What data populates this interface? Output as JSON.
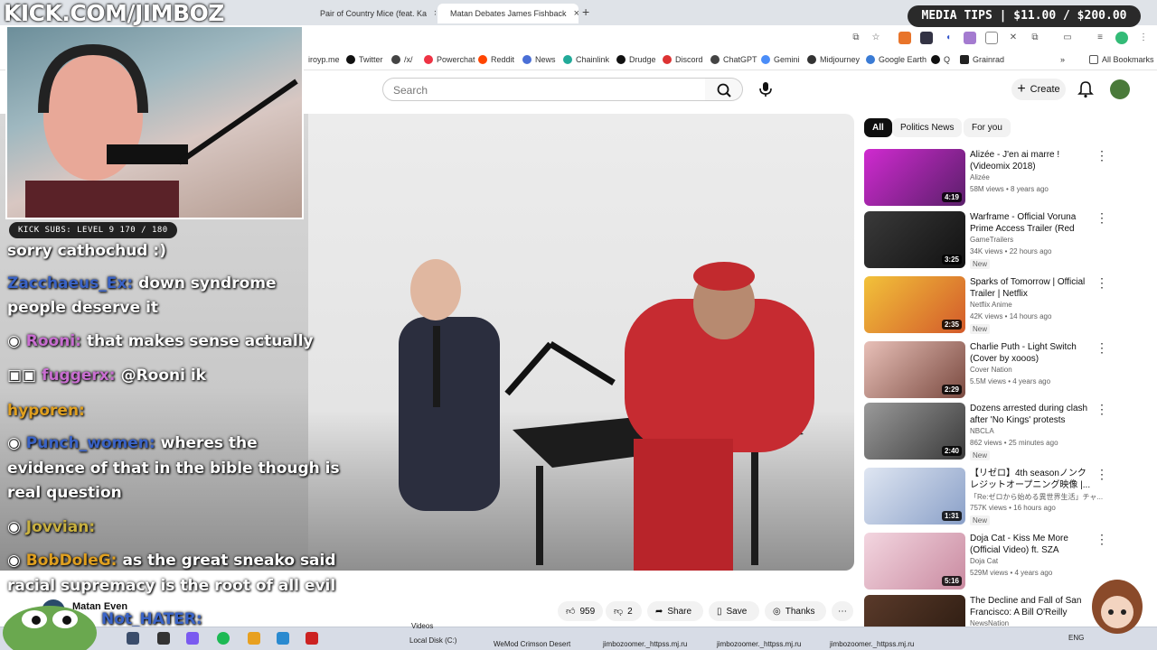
{
  "overlay": {
    "kick_title": "KICK.COM/JIMBOZ",
    "media_tips": "MEDIA TIPS | $11.00 / $200.00",
    "kick_subs": "KICK SUBS: LEVEL 9 170 / 180"
  },
  "browser": {
    "tabs": [
      {
        "label": "Pair of Country Mice (feat. Ka",
        "active": false
      },
      {
        "label": "Matan Debates James Fishback",
        "active": true
      }
    ],
    "bookmarks": [
      "iroyp.me",
      "Twitter",
      "/x/",
      "Powerchat",
      "Reddit",
      "News",
      "Chainlink",
      "Drudge",
      "Discord",
      "ChatGPT",
      "Gemini",
      "Midjourney",
      "Google Earth",
      "Q",
      "Grainrad"
    ],
    "all_bookmarks": "All Bookmarks"
  },
  "youtube": {
    "search_placeholder": "Search",
    "create_label": "Create",
    "chips": [
      "All",
      "Politics News",
      "For you"
    ],
    "recommendations": [
      {
        "title": "Alizée - J'en ai marre ! (Videomix 2018)",
        "channel": "Alizée",
        "meta": "58M views • 8 years ago",
        "duration": "4:19",
        "new": ""
      },
      {
        "title": "Warframe - Official Voruna Prime Access Trailer (Red Ban...",
        "channel": "GameTrailers",
        "meta": "34K views • 22 hours ago",
        "duration": "3:25",
        "new": "New"
      },
      {
        "title": "Sparks of Tomorrow | Official Trailer | Netflix",
        "channel": "Netflix Anime",
        "meta": "42K views • 14 hours ago",
        "duration": "2:35",
        "new": "New"
      },
      {
        "title": "Charlie Puth - Light Switch (Cover by xooos)",
        "channel": "Cover Nation",
        "meta": "5.5M views • 4 years ago",
        "duration": "2:29",
        "new": ""
      },
      {
        "title": "Dozens arrested during clash after 'No Kings' protests",
        "channel": "NBCLA",
        "meta": "862 views • 25 minutes ago",
        "duration": "2:40",
        "new": "New"
      },
      {
        "title": "【リゼロ】4th seasonノンクレジットオープニング映像 |...",
        "channel": "「Re:ゼロから始める異世界生活」チャ...",
        "meta": "757K views • 16 hours ago",
        "duration": "1:31",
        "new": "New"
      },
      {
        "title": "Doja Cat - Kiss Me More (Official Video) ft. SZA",
        "channel": "Doja Cat",
        "meta": "529M views • 4 years ago",
        "duration": "5:16",
        "new": ""
      },
      {
        "title": "The Decline and Fall of San Francisco: A Bill O'Reilly Speci...",
        "channel": "NewsNation",
        "meta": "",
        "duration": "",
        "new": ""
      }
    ],
    "channel_name": "Matan Even",
    "likes": "959",
    "dislikes": "2",
    "share": "Share",
    "save": "Save",
    "thanks": "Thanks"
  },
  "chat": [
    {
      "user": "",
      "text": "sorry cathochud :)"
    },
    {
      "user": "Zacchaeus_Ex:",
      "text": "down syndrome"
    },
    {
      "user": "",
      "text": "people deserve it"
    },
    {
      "user": "Rooni:",
      "text": "that makes sense actually"
    },
    {
      "user": "fuggerx:",
      "text": "@Rooni ik"
    },
    {
      "user": "hyporen:",
      "text": ""
    },
    {
      "user": "Punch_women:",
      "text": "wheres the"
    },
    {
      "user": "",
      "text": "evidence of that in the bible though is"
    },
    {
      "user": "",
      "text": "real question"
    },
    {
      "user": "Jovvian:",
      "text": ""
    },
    {
      "user": "BobDoleG:",
      "text": "as the great sneako said"
    },
    {
      "user": "",
      "text": "racial supremacy is the root of all evil"
    },
    {
      "user": "Not_HATER:",
      "text": ""
    }
  ],
  "taskbar": {
    "labels": [
      "Videos",
      "Local Disk (C:)",
      "WeMod Crimson Desert",
      "jimbozoomer._httpss.mj.ru",
      "jimbozoomer._httpss.mj.ru",
      "jimbozoomer._httpss.mj.ru"
    ],
    "lang": "ENG"
  }
}
